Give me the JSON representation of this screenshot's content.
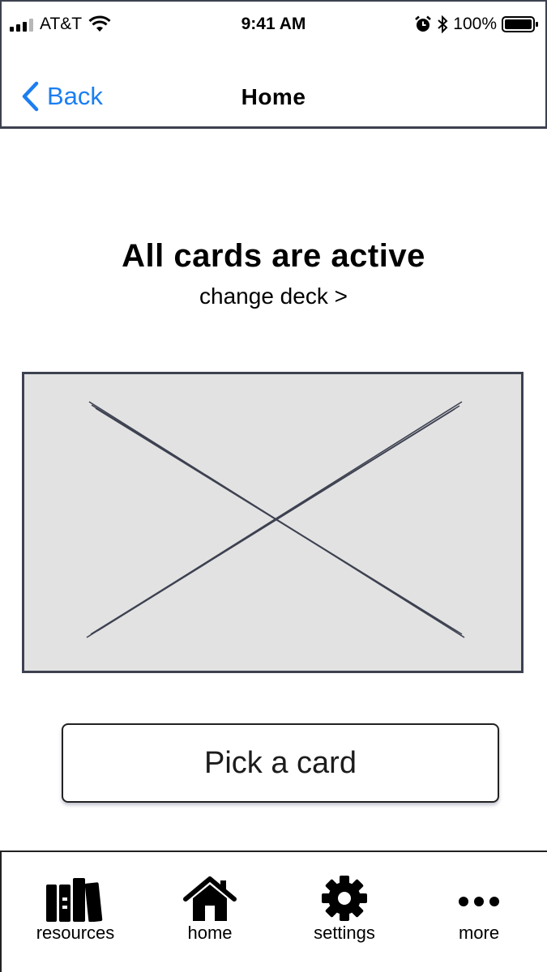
{
  "status_bar": {
    "carrier": "AT&T",
    "time": "9:41 AM",
    "battery": "100%"
  },
  "nav": {
    "back_label": "Back",
    "title": "Home"
  },
  "main": {
    "headline": "All cards are active",
    "change_deck": "change deck >",
    "card_image": "image-placeholder",
    "pick_button": "Pick a card"
  },
  "tab_bar": {
    "items": [
      {
        "label": "resources",
        "icon": "books-icon"
      },
      {
        "label": "home",
        "icon": "home-icon"
      },
      {
        "label": "settings",
        "icon": "gear-icon"
      },
      {
        "label": "more",
        "icon": "more-icon"
      }
    ]
  },
  "colors": {
    "accent": "#1b7ef1",
    "frame": "#3d4150",
    "placeholder_fill": "#e2e2e2"
  }
}
